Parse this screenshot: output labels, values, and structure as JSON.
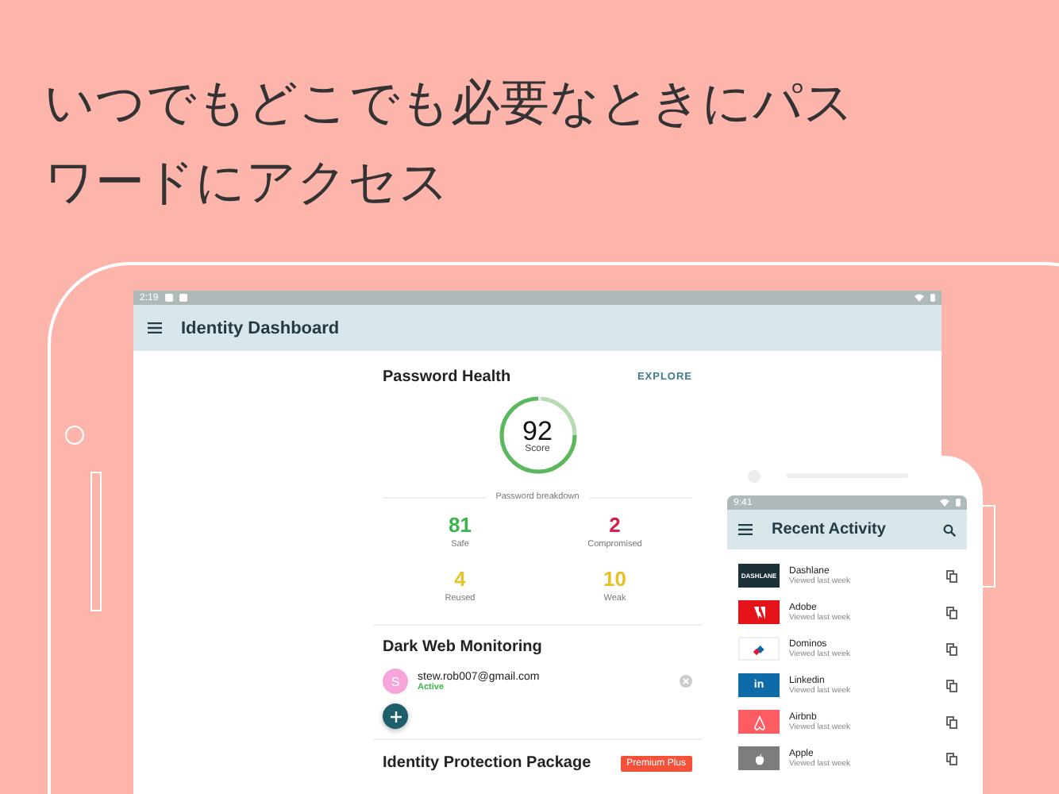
{
  "headline": "いつでもどこでも必要なときにパスワードにアクセス",
  "tablet": {
    "status_time": "2:19",
    "title": "Identity Dashboard",
    "password_health": {
      "title": "Password Health",
      "action": "EXPLORE",
      "score": "92",
      "score_label": "Score",
      "breakdown_label": "Password breakdown",
      "stats": [
        {
          "value": "81",
          "label": "Safe",
          "color": "#3bb54a"
        },
        {
          "value": "2",
          "label": "Compromised",
          "color": "#d0234b"
        },
        {
          "value": "4",
          "label": "Reused",
          "color": "#e6c22a"
        },
        {
          "value": "10",
          "label": "Weak",
          "color": "#e6c22a"
        }
      ]
    },
    "dark_web": {
      "title": "Dark Web Monitoring",
      "emails": [
        {
          "initial": "S",
          "email": "stew.rob007@gmail.com",
          "status": "Active"
        }
      ]
    },
    "identity": {
      "title": "Identity Protection Package",
      "badge": "Premium Plus"
    }
  },
  "phone": {
    "status_time": "9:41",
    "title": "Recent Activity",
    "items": [
      {
        "name": "Dashlane",
        "subtitle": "Viewed last week",
        "kind": "text",
        "logo_text": "DASHLANE",
        "color": "#1c3038"
      },
      {
        "name": "Adobe",
        "subtitle": "Viewed last week",
        "kind": "adobe",
        "color": "#e5141b"
      },
      {
        "name": "Dominos",
        "subtitle": "Viewed last week",
        "kind": "dominos",
        "color": "#ffffff"
      },
      {
        "name": "Linkedin",
        "subtitle": "Viewed last week",
        "kind": "text",
        "logo_text": "in",
        "color": "#0e6ba8"
      },
      {
        "name": "Airbnb",
        "subtitle": "Viewed last week",
        "kind": "airbnb",
        "color": "#fd5c63"
      },
      {
        "name": "Apple",
        "subtitle": "Viewed last week",
        "kind": "apple",
        "color": "#7d7d7d"
      }
    ]
  }
}
